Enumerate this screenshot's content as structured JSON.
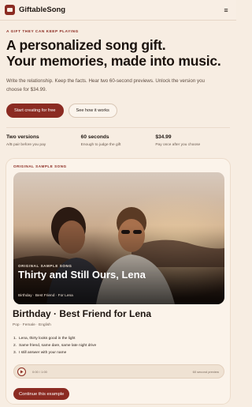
{
  "brand": {
    "name": "GiftableSong"
  },
  "nav": {
    "menu_glyph": "≡"
  },
  "hero": {
    "eyebrow": "A GIFT THEY CAN KEEP PLAYING",
    "headline_line1": "A personalized song gift.",
    "headline_line2": "Your memories, made into music.",
    "lede": "Write the relationship. Keep the facts. Hear two 60-second previews. Unlock the version you choose for $34.99.",
    "primary_cta": "Start creating for free",
    "secondary_cta": "See how it works"
  },
  "facts": [
    {
      "title": "Two versions",
      "sub": "A/B pair before you pay"
    },
    {
      "title": "60 seconds",
      "sub": "Enough to judge the gift"
    },
    {
      "title": "$34.99",
      "sub": "Pay once after you choose"
    }
  ],
  "sample": {
    "eyebrow": "ORIGINAL SAMPLE SONG",
    "photo_label": "ORIGINAL SAMPLE SONG",
    "photo_title": "Thirty and Still Ours, Lena",
    "photo_tags": "Birthday · Best Friend · For Lena",
    "title": "Birthday · Best Friend for Lena",
    "meta": "Pop · Female · English",
    "lyrics": [
      {
        "n": "1.",
        "text": "Lena, thirty looks good in the light"
      },
      {
        "n": "2.",
        "text": "Same friend, same dare, same late night drive"
      },
      {
        "n": "3.",
        "text": "I still answer with your name"
      }
    ],
    "player": {
      "time": "0:00 / 1:00",
      "note": "60 second preview"
    },
    "continue_cta": "Continue this example"
  },
  "colors": {
    "accent": "#8b2b22",
    "background": "#f7ede2",
    "card": "#fbf3ea"
  },
  "icons": {
    "logo": "gift-icon",
    "menu": "hamburger-icon",
    "play": "play-icon"
  }
}
